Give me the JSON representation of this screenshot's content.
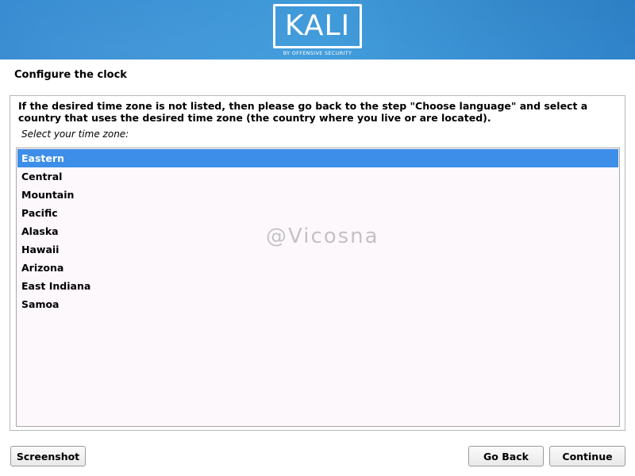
{
  "banner": {
    "logo_text": "KALI",
    "logo_subtext": "BY OFFENSIVE SECURITY",
    "color": "#3a9bdf"
  },
  "page": {
    "title": "Configure the clock"
  },
  "panel": {
    "instructions": "If the desired time zone is not listed, then please go back to the step \"Choose language\" and select a country that uses the desired time zone (the country where you live or are located).",
    "prompt": "Select your time zone:",
    "selected_color": "#3d8ee8",
    "timezones": [
      {
        "label": "Eastern",
        "selected": true
      },
      {
        "label": "Central",
        "selected": false
      },
      {
        "label": "Mountain",
        "selected": false
      },
      {
        "label": "Pacific",
        "selected": false
      },
      {
        "label": "Alaska",
        "selected": false
      },
      {
        "label": "Hawaii",
        "selected": false
      },
      {
        "label": "Arizona",
        "selected": false
      },
      {
        "label": "East Indiana",
        "selected": false
      },
      {
        "label": "Samoa",
        "selected": false
      }
    ]
  },
  "watermark": "@Vicosna",
  "buttons": {
    "screenshot": "Screenshot",
    "go_back": "Go Back",
    "continue": "Continue"
  }
}
